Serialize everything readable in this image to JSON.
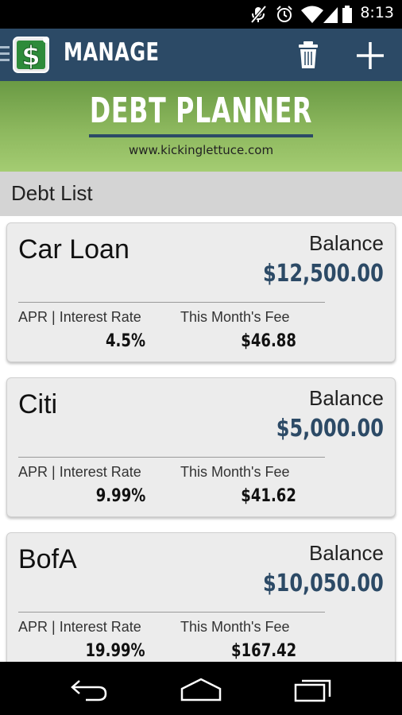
{
  "status_bar": {
    "time": "8:13",
    "icons": [
      "mic-muted-icon",
      "alarm-icon",
      "wifi-icon",
      "cell-signal-icon",
      "battery-icon"
    ]
  },
  "action_bar": {
    "title": "MANAGE",
    "icons": {
      "logo": "dollar-logo-icon",
      "delete": "trash-icon",
      "add": "plus-icon"
    },
    "color": "#2c4a66"
  },
  "banner": {
    "title": "DEBT PLANNER",
    "url": "www.kickinglettuce.com",
    "color": "#8db85e"
  },
  "list_header": {
    "label": "Debt List"
  },
  "debts": [
    {
      "name": "Car Loan",
      "balance_label": "Balance",
      "balance": "$12,500.00",
      "apr_label": "APR | Interest Rate",
      "apr": "4.5%",
      "fee_label": "This Month's Fee",
      "fee": "$46.88"
    },
    {
      "name": "Citi",
      "balance_label": "Balance",
      "balance": "$5,000.00",
      "apr_label": "APR | Interest Rate",
      "apr": "9.99%",
      "fee_label": "This Month's Fee",
      "fee": "$41.62"
    },
    {
      "name": "BofA",
      "balance_label": "Balance",
      "balance": "$10,050.00",
      "apr_label": "APR | Interest Rate",
      "apr": "19.99%",
      "fee_label": "This Month's Fee",
      "fee": "$167.42"
    }
  ],
  "nav_bar": {
    "icons": [
      "back-icon",
      "home-icon",
      "recent-apps-icon"
    ]
  }
}
